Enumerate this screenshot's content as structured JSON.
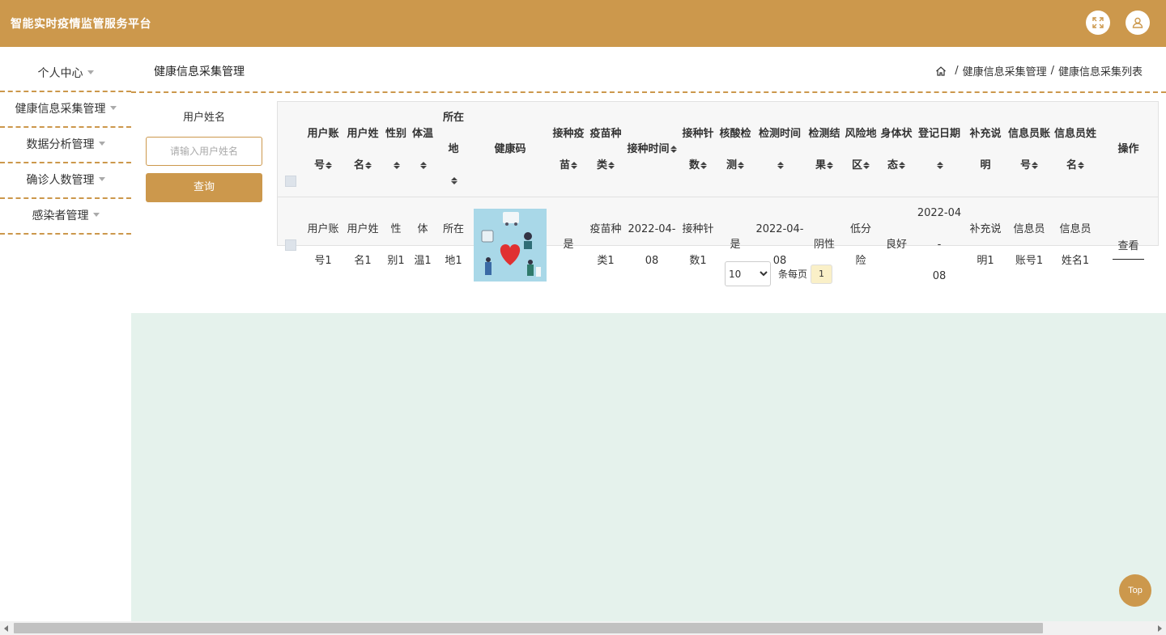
{
  "app": {
    "title": "智能实时疫情监管服务平台",
    "accent_color": "#cc984c",
    "content_bg_color": "#e5f2ec",
    "icons": [
      "fullscreen-icon",
      "user-icon"
    ]
  },
  "sidebar": {
    "items": [
      {
        "label": "个人中心"
      },
      {
        "label": "健康信息采集管理"
      },
      {
        "label": "数据分析管理"
      },
      {
        "label": "确诊人数管理"
      },
      {
        "label": "感染者管理"
      }
    ]
  },
  "page": {
    "title": "健康信息采集管理",
    "breadcrumb": [
      "健康信息采集管理",
      "健康信息采集列表"
    ],
    "breadcrumb_sep": "/"
  },
  "search": {
    "label": "用户姓名",
    "placeholder": "请输入用户姓名",
    "value": "",
    "button_label": "查询"
  },
  "table": {
    "columns": [
      {
        "l1": "用户账",
        "l2": "号",
        "sortable": true
      },
      {
        "l1": "用户姓",
        "l2": "名",
        "sortable": true
      },
      {
        "l1": "",
        "l2": "性别",
        "sortable": true
      },
      {
        "l1": "",
        "l2": "体温",
        "sortable": true
      },
      {
        "l1": "所在地",
        "l2": "",
        "sortable": true
      },
      {
        "l1": "",
        "l2": "健康码",
        "sortable": false
      },
      {
        "l1": "接种疫",
        "l2": "苗",
        "sortable": true
      },
      {
        "l1": "疫苗种",
        "l2": "类",
        "sortable": true
      },
      {
        "l1": "",
        "l2": "接种时间",
        "sortable": true
      },
      {
        "l1": "接种针",
        "l2": "数",
        "sortable": true
      },
      {
        "l1": "核酸检",
        "l2": "测",
        "sortable": true
      },
      {
        "l1": "",
        "l2": "检测时间",
        "sortable": true
      },
      {
        "l1": "检测结",
        "l2": "果",
        "sortable": true
      },
      {
        "l1": "风险地",
        "l2": "区",
        "sortable": true
      },
      {
        "l1": "身体状",
        "l2": "态",
        "sortable": true
      },
      {
        "l1": "",
        "l2": "登记日期",
        "sortable": true
      },
      {
        "l1": "补充说",
        "l2": "明",
        "sortable": false
      },
      {
        "l1": "信息员账",
        "l2": "号",
        "sortable": true
      },
      {
        "l1": "信息员姓",
        "l2": "名",
        "sortable": true
      },
      {
        "l1": "",
        "l2": "操作",
        "sortable": false
      }
    ],
    "rows": [
      {
        "cells": [
          [
            "用户账",
            "号1"
          ],
          [
            "用户姓",
            "名1"
          ],
          [
            "性",
            "别1"
          ],
          [
            "体",
            "温1"
          ],
          [
            "所在",
            "地1"
          ],
          null,
          [
            "是"
          ],
          [
            "疫苗种",
            "类1"
          ],
          [
            "2022-04-",
            "08"
          ],
          [
            "接种针",
            "数1"
          ],
          [
            "是"
          ],
          [
            "2022-04-",
            "08"
          ],
          [
            "阴性"
          ],
          [
            "低分",
            "险"
          ],
          [
            "良好"
          ],
          [
            "2022-04-",
            "08"
          ],
          [
            "补充说",
            "明1"
          ],
          [
            "信息员",
            "账号1"
          ],
          [
            "信息员",
            "姓名1"
          ]
        ],
        "action_label": "查看"
      }
    ]
  },
  "pagination": {
    "page_size_options": [
      "10"
    ],
    "page_size": "10",
    "per_page_label": "条每页",
    "current_page": "1"
  },
  "back_to_top_label": "Top"
}
